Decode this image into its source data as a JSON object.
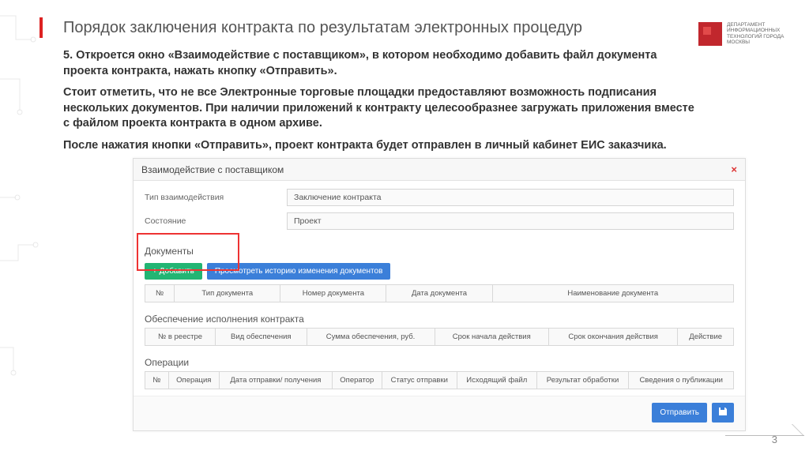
{
  "slide": {
    "title": "Порядок заключения контракта по результатам электронных процедур",
    "para1": "5. Откроется окно «Взаимодействие с поставщиком», в котором необходимо добавить файл документа проекта контракта, нажать кнопку «Отправить».",
    "para2": "Стоит отметить, что не все Электронные торговые площадки предоставляют возможность подписания нескольких документов. При наличии приложений к контракту целесообразнее загружать приложения вместе с файлом проекта контракта в одном архиве.",
    "para3": "После нажатия кнопки «Отправить», проект контракта будет отправлен в личный кабинет ЕИС заказчика.",
    "page_number": "3",
    "logo_text": "ДЕПАРТАМЕНТ ИНФОРМАЦИОННЫХ ТЕХНОЛОГИЙ ГОРОДА МОСКВЫ"
  },
  "window": {
    "title": "Взаимодействие с поставщиком",
    "type_label": "Тип взаимодействия",
    "type_value": "Заключение контракта",
    "state_label": "Состояние",
    "state_value": "Проект",
    "documents_section": "Документы",
    "add_button": "+ Добавить",
    "history_button": "Просмотреть историю изменения документов",
    "docs_table": {
      "h1": "№",
      "h2": "Тип документа",
      "h3": "Номер документа",
      "h4": "Дата документа",
      "h5": "Наименование документа"
    },
    "assurance_section": "Обеспечение исполнения контракта",
    "assurance_table": {
      "h1": "№ в реестре",
      "h2": "Вид обеспечения",
      "h3": "Сумма обеспечения, руб.",
      "h4": "Срок начала действия",
      "h5": "Срок окончания действия",
      "h6": "Действие"
    },
    "operations_section": "Операции",
    "ops_table": {
      "h1": "№",
      "h2": "Операция",
      "h3": "Дата отправки/ получения",
      "h4": "Оператор",
      "h5": "Статус отправки",
      "h6": "Исходящий файл",
      "h7": "Результат обработки",
      "h8": "Сведения о публикации"
    },
    "send_button": "Отправить"
  }
}
